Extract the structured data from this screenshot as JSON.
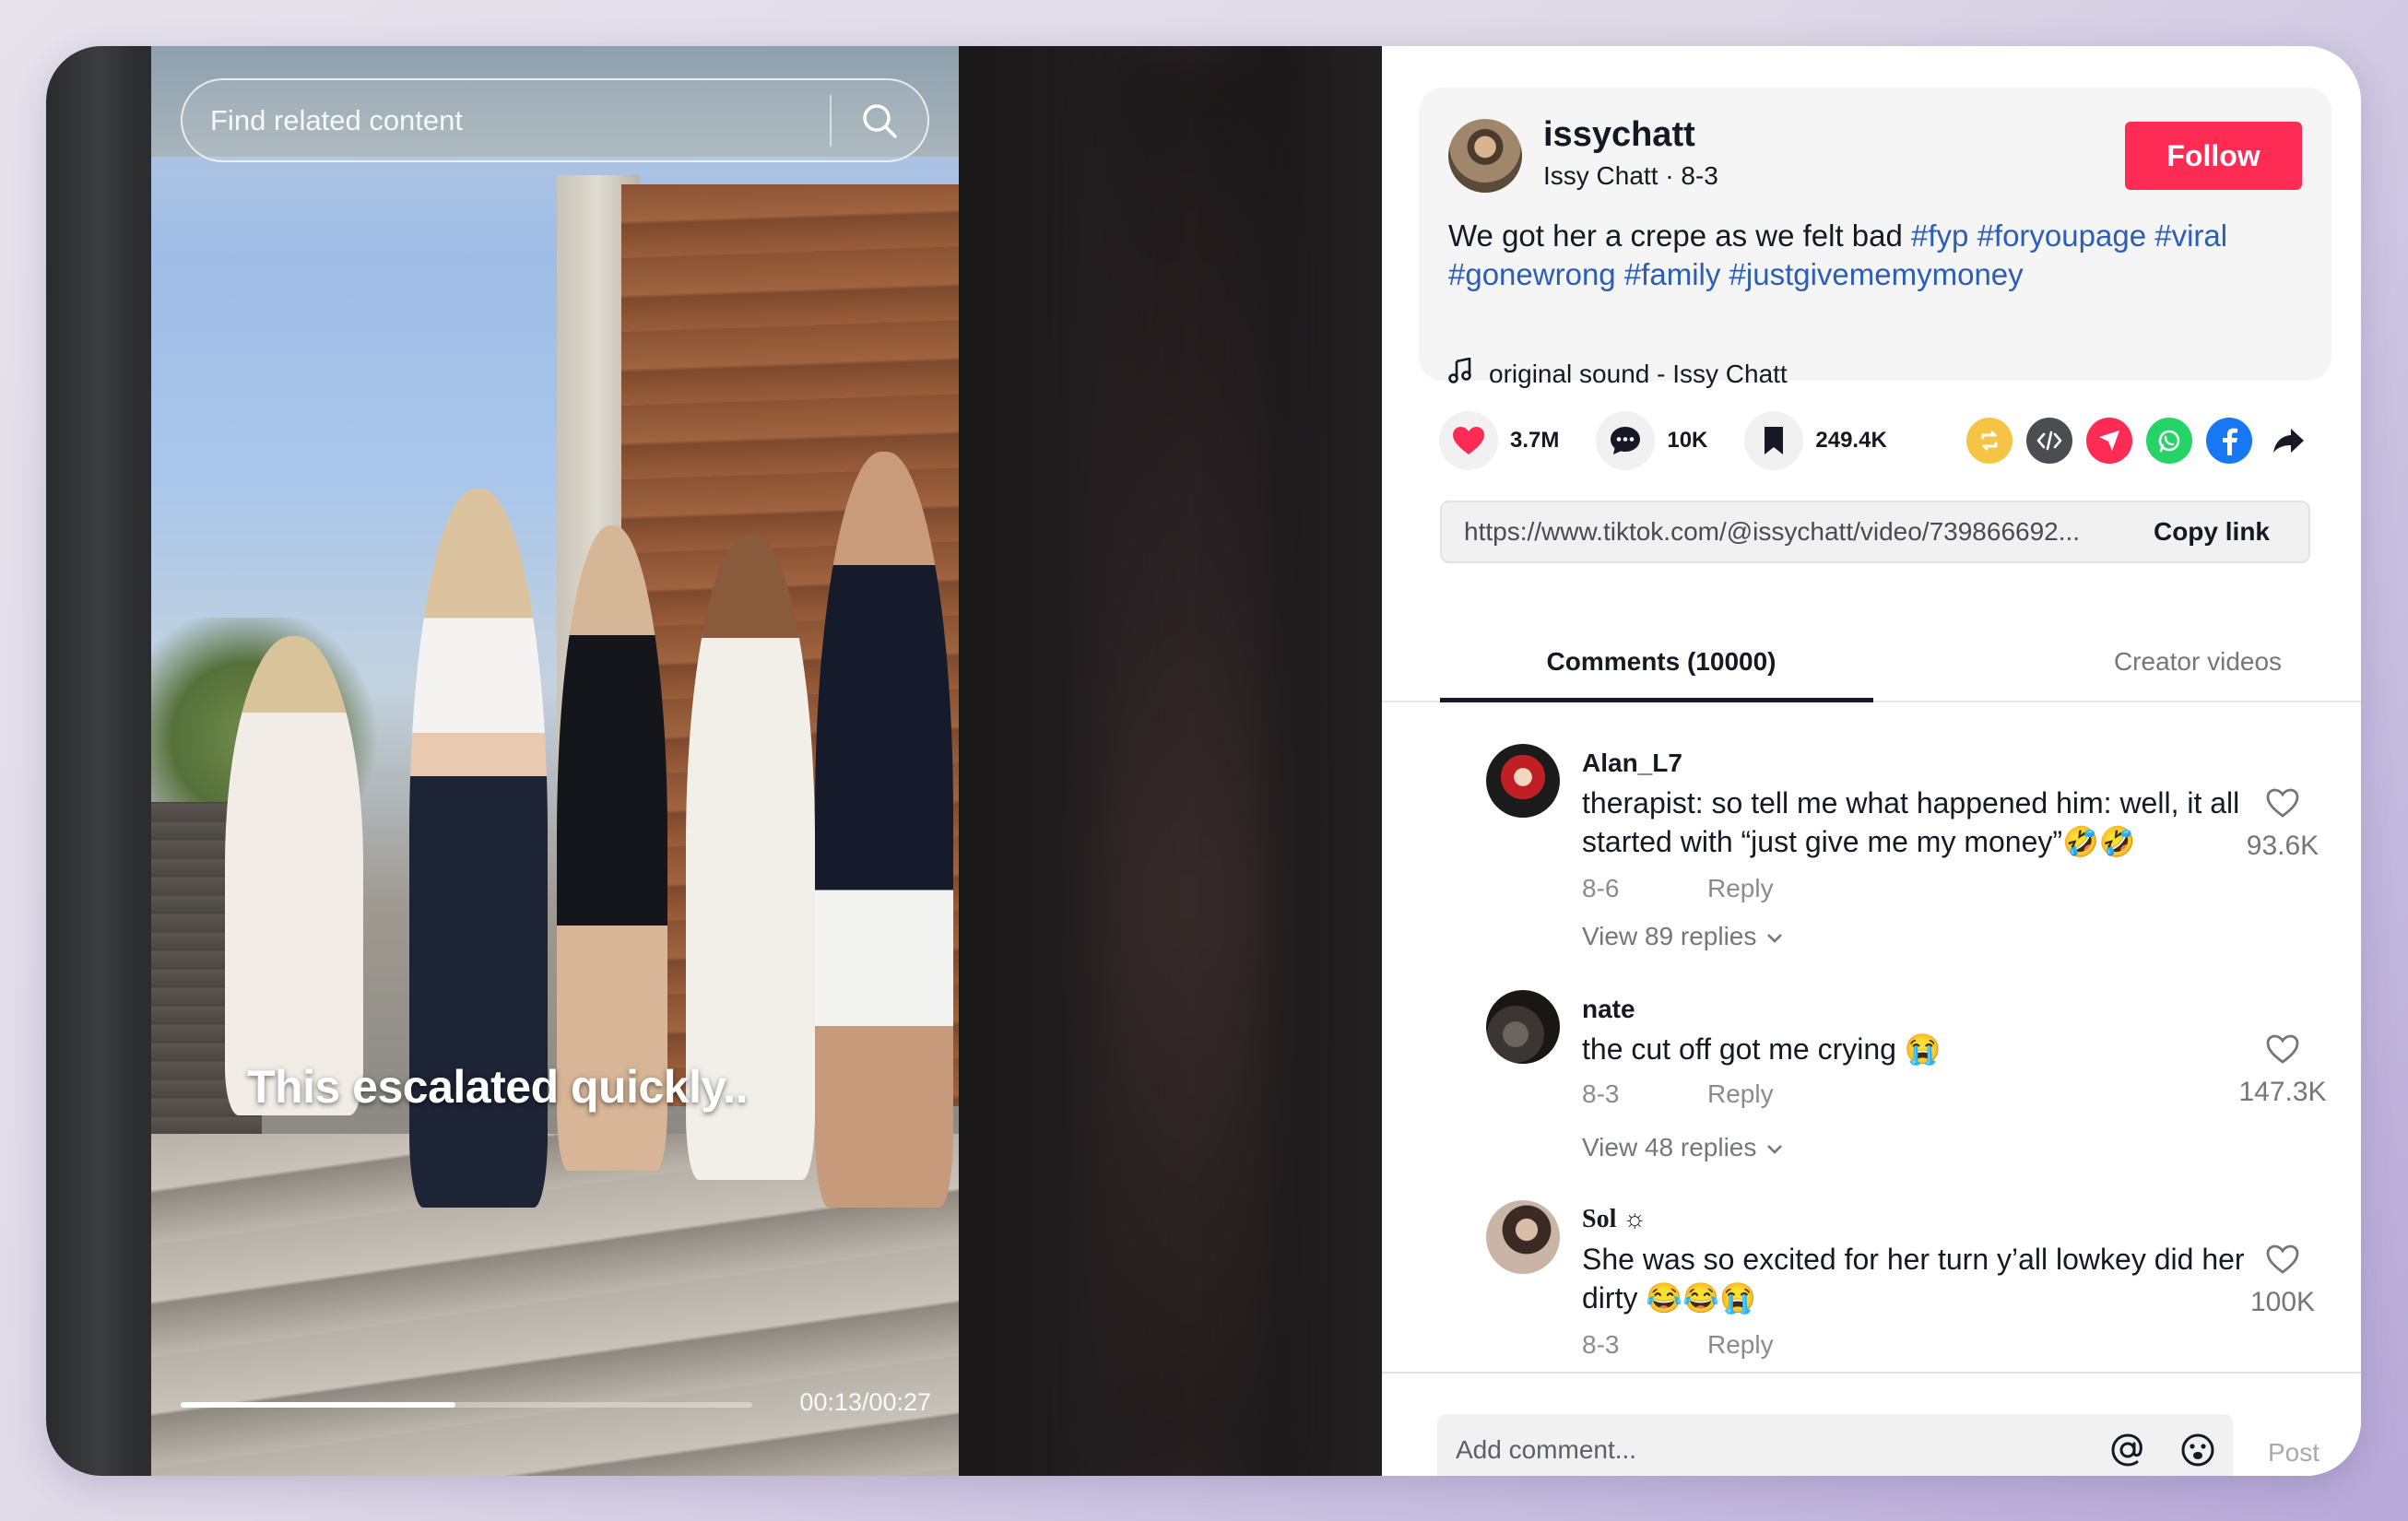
{
  "video": {
    "search_placeholder": "Find related content",
    "caption": "This escalated quickly..",
    "time": "00:13/00:27",
    "progress_fraction": 0.48
  },
  "creator": {
    "username": "issychatt",
    "subline": "Issy Chatt · 8-3",
    "follow_label": "Follow",
    "description_text": "We got her a crepe as we felt bad ",
    "hashtags": [
      "#fyp",
      "#foryoupage",
      "#viral",
      "#gonewrong",
      "#family",
      "#justgivememymoney"
    ],
    "music": "original sound - Issy Chatt"
  },
  "actions": {
    "likes": "3.7M",
    "comments": "10K",
    "saves": "249.4K",
    "like_color": "#fe2c55",
    "share_icons": [
      "repost-icon",
      "embed-icon",
      "send-icon",
      "whatsapp-icon",
      "facebook-icon",
      "share-arrow-icon"
    ]
  },
  "link": {
    "url": "https://www.tiktok.com/@issychatt/video/739866692...",
    "copy_label": "Copy link"
  },
  "tabs": {
    "comments": "Comments (10000)",
    "creator_videos": "Creator videos"
  },
  "comments": [
    {
      "name": "Alan_L7",
      "text": "therapist: so tell me what happened him: well, it all started with “just give me my money”🤣🤣",
      "date": "8-6",
      "reply": "Reply",
      "view_replies": "View 89 replies",
      "likes": "93.6K"
    },
    {
      "name": "nate",
      "text": "the cut off got me crying 😭",
      "date": "8-3",
      "reply": "Reply",
      "view_replies": "View 48 replies",
      "likes": "147.3K"
    },
    {
      "name": "Sol ☼",
      "text": "She was so excited for her turn y’all lowkey did her dirty 😂😂😭",
      "date": "8-3",
      "reply": "Reply",
      "likes": "100K"
    }
  ],
  "comment_bar": {
    "placeholder": "Add comment...",
    "post_label": "Post"
  },
  "colors": {
    "accent": "#fe2c55",
    "hashtag": "#2b5db9"
  }
}
